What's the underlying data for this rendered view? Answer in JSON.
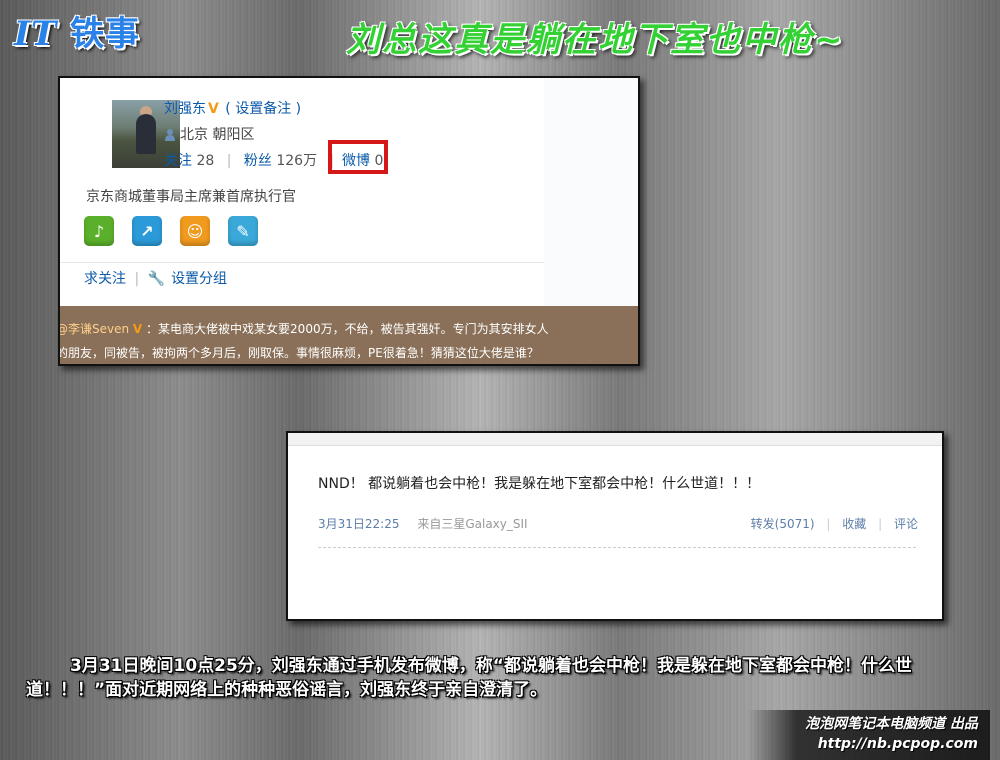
{
  "header": {
    "logo_it": "IT",
    "logo_text": "铁事",
    "headline": "刘总这真是躺在地下室也中枪~"
  },
  "profile_card": {
    "name": "刘强东",
    "remark_link": "( 设置备注 )",
    "location": "北京 朝阳区",
    "following_label": "关注",
    "following_count": "28",
    "followers_label": "粉丝",
    "followers_count": "126万",
    "weibo_label": "微博",
    "weibo_count": "0",
    "bio": "京东商城董事局主席兼首席执行官",
    "app_icons": [
      "app-icon-1",
      "app-icon-2",
      "app-icon-3",
      "app-icon-4"
    ],
    "request_follow": "求关注",
    "set_group": "设置分组",
    "tweet_user": "@李谦Seven",
    "tweet_line1": "：某电商大佬被中戏某女要2000万，不给，被告其强奸。专门为其安排女人",
    "tweet_line2": "的朋友，同被告，被拘两个多月后，刚取保。事情很麻烦，PE很着急！猜猜这位大佬是谁？"
  },
  "post_card": {
    "text": "NND！ 都说躺着也会中枪！我是躲在地下室都会中枪！什么世道！！！",
    "time": "3月31日22:25",
    "source": "来自三星Galaxy_SII",
    "repost": "转发(5071)",
    "favorite": "收藏",
    "comment": "评论",
    "sep": "|"
  },
  "caption": "3月31日晚间10点25分，刘强东通过手机发布微博，称“都说躺着也会中枪！我是躲在地下室都会中枪！什么世道！！！”面对近期网络上的种种恶俗谣言，刘强东终于亲自澄清了。",
  "footer": {
    "line1": "泡泡网笔记本电脑频道 出品",
    "line2": "http://nb.pcpop.com"
  },
  "colors": {
    "accent_blue": "#0a5aa8",
    "verified_orange": "#f59a14",
    "highlight_red": "#d61717",
    "headline_green": "#33d133"
  }
}
